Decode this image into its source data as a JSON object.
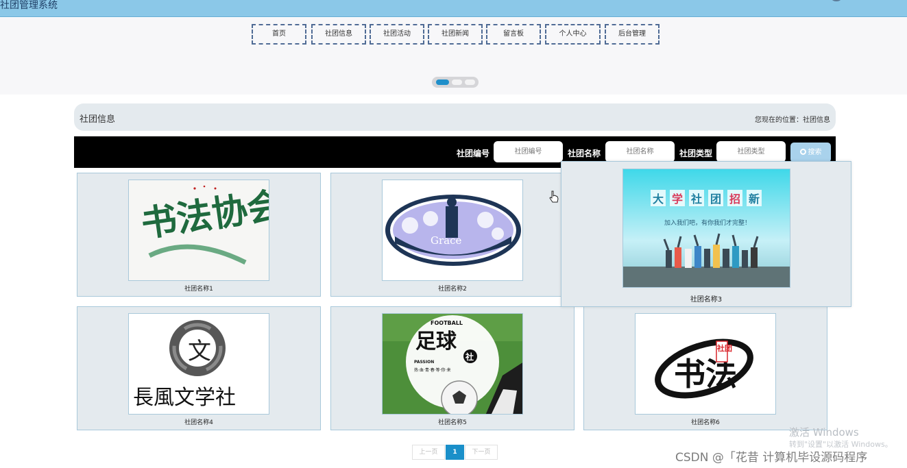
{
  "app": {
    "title": "社团管理系统"
  },
  "nav": [
    "首页",
    "社团信息",
    "社团活动",
    "社团新闻",
    "留言板",
    "个人中心",
    "后台管理"
  ],
  "section": {
    "title": "社团信息",
    "location": "您现在的位置：社团信息"
  },
  "search": {
    "fields": [
      {
        "label": "社团编号",
        "placeholder": "社团编号"
      },
      {
        "label": "社团名称",
        "placeholder": "社团名称"
      },
      {
        "label": "社团类型",
        "placeholder": "社团类型"
      }
    ],
    "button_label": "搜索"
  },
  "clubs": [
    {
      "name": "社团名称1",
      "image_text": "书法协会"
    },
    {
      "name": "社团名称2",
      "image_text": "Grace"
    },
    {
      "name": "社团名称3",
      "image_text": [
        "大",
        "学",
        "社",
        "团",
        "招",
        "新"
      ],
      "image_subtitle": "加入我们吧，有你我们才完整！"
    },
    {
      "name": "社团名称4",
      "image_text": "長風文学社"
    },
    {
      "name": "社团名称5",
      "image_text": [
        "FOOTBALL",
        "足球",
        "社",
        "PASSION",
        "热·血·青·春·等·你·来"
      ]
    },
    {
      "name": "社团名称6",
      "image_text": [
        "书法",
        "社团"
      ]
    }
  ],
  "pagination": {
    "prev": "上一页",
    "current": "1",
    "next": "下一页"
  },
  "watermark": {
    "line1": "激活 Windows",
    "line2": "转到\"设置\"以激活 Windows。",
    "credit": "CSDN @「花昔  计算机毕设源码程序"
  },
  "colors": {
    "header": "#8bc8e8",
    "active": "#1a8fc9",
    "panel": "#e4eaee",
    "searchbar": "#000000"
  },
  "carousel": {
    "slides": 3,
    "active": 1
  }
}
